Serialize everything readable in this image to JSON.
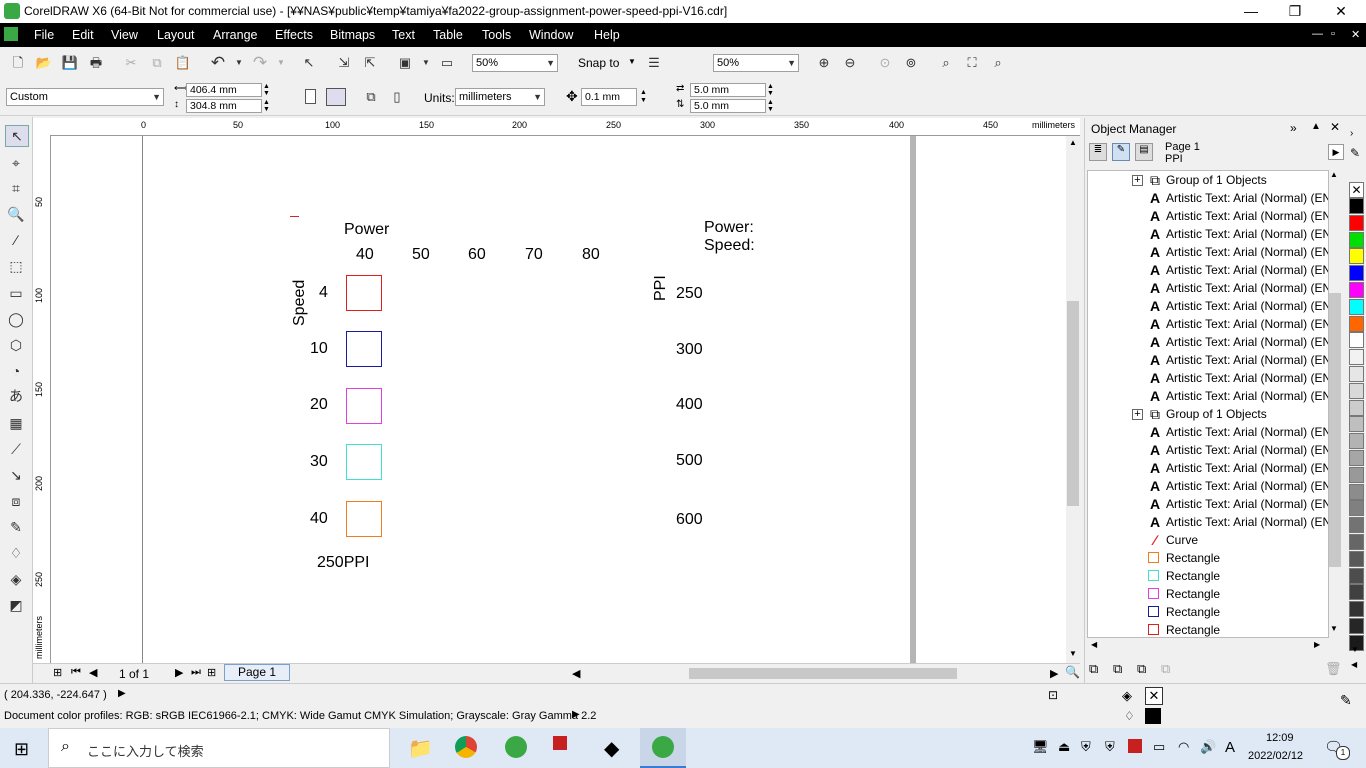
{
  "window": {
    "title": "CorelDRAW X6 (64-Bit Not for commercial use) - [¥¥NAS¥public¥temp¥tamiya¥fa2022-group-assignment-power-speed-ppi-V16.cdr]",
    "minimize": "—",
    "restore": "❐",
    "close": "✕"
  },
  "menu": {
    "items": [
      "File",
      "Edit",
      "View",
      "Layout",
      "Arrange",
      "Effects",
      "Bitmaps",
      "Text",
      "Table",
      "Tools",
      "Window",
      "Help"
    ],
    "doc_controls": [
      "—",
      "▫",
      "✕"
    ]
  },
  "toolbar1": {
    "zoom_value": "50%",
    "snap_to": "Snap to",
    "zoom_value2": "50%"
  },
  "toolbar2": {
    "page_preset": "Custom",
    "width": "406.4 mm",
    "height": "304.8 mm",
    "units_label": "Units:",
    "units_value": "millimeters",
    "nudge": "0.1 mm",
    "dup_x": "5.0 mm",
    "dup_y": "5.0 mm"
  },
  "ruler": {
    "h_labels": [
      "0",
      "50",
      "100",
      "150",
      "200",
      "250",
      "300",
      "350",
      "400",
      "450"
    ],
    "h_unit": "millimeters",
    "v_labels": [
      "50",
      "100",
      "150",
      "200",
      "250"
    ],
    "v_unit": "millimeters"
  },
  "canvas": {
    "power_label": "Power",
    "power_values": [
      "40",
      "50",
      "60",
      "70",
      "80"
    ],
    "speed_label": "Speed",
    "speed_values": [
      "4",
      "10",
      "20",
      "30",
      "40"
    ],
    "square_colors": [
      "#e02020",
      "#1a1aa0",
      "#e040e0",
      "#40e0d0",
      "#f07c20"
    ],
    "footer_label": "250PPI",
    "right_power": "Power:",
    "right_speed": "Speed:",
    "ppi_label": "PPI",
    "ppi_values": [
      "250",
      "300",
      "400",
      "500",
      "600"
    ]
  },
  "page_nav": {
    "page_count": "1 of 1",
    "page_tab": "Page 1"
  },
  "object_manager": {
    "title": "Object Manager",
    "page": "Page 1",
    "layer": "PPI",
    "rows": [
      {
        "type": "group",
        "label": "Group of 1 Objects"
      },
      {
        "type": "text",
        "label": "Artistic Text: Arial (Normal) (EN"
      },
      {
        "type": "text",
        "label": "Artistic Text: Arial (Normal) (EN"
      },
      {
        "type": "text",
        "label": "Artistic Text: Arial (Normal) (EN"
      },
      {
        "type": "text",
        "label": "Artistic Text: Arial (Normal) (EN"
      },
      {
        "type": "text",
        "label": "Artistic Text: Arial (Normal) (EN"
      },
      {
        "type": "text",
        "label": "Artistic Text: Arial (Normal) (EN"
      },
      {
        "type": "text",
        "label": "Artistic Text: Arial (Normal) (EN"
      },
      {
        "type": "text",
        "label": "Artistic Text: Arial (Normal) (EN"
      },
      {
        "type": "text",
        "label": "Artistic Text: Arial (Normal) (EN"
      },
      {
        "type": "text",
        "label": "Artistic Text: Arial (Normal) (EN"
      },
      {
        "type": "text",
        "label": "Artistic Text: Arial (Normal) (EN"
      },
      {
        "type": "text",
        "label": "Artistic Text: Arial (Normal) (EN"
      },
      {
        "type": "group",
        "label": "Group of 1 Objects"
      },
      {
        "type": "text",
        "label": "Artistic Text: Arial (Normal) (EN"
      },
      {
        "type": "text",
        "label": "Artistic Text: Arial (Normal) (EN"
      },
      {
        "type": "text",
        "label": "Artistic Text: Arial (Normal) (EN"
      },
      {
        "type": "text",
        "label": "Artistic Text: Arial (Normal) (EN"
      },
      {
        "type": "text",
        "label": "Artistic Text: Arial (Normal) (EN"
      },
      {
        "type": "text",
        "label": "Artistic Text: Arial (Normal) (EN"
      },
      {
        "type": "curve",
        "label": "Curve",
        "color": "#e02020"
      },
      {
        "type": "rect",
        "label": "Rectangle",
        "color": "#f07c20"
      },
      {
        "type": "rect",
        "label": "Rectangle",
        "color": "#40e0d0"
      },
      {
        "type": "rect",
        "label": "Rectangle",
        "color": "#e040e0"
      },
      {
        "type": "rect",
        "label": "Rectangle",
        "color": "#1a1aa0"
      },
      {
        "type": "rect",
        "label": "Rectangle",
        "color": "#e02020"
      }
    ]
  },
  "palette": [
    "#000000",
    "#ff0000",
    "#00e000",
    "#ffff00",
    "#0000ff",
    "#ff00ff",
    "#00ffff",
    "#ff6600",
    "#ffffff",
    "#f2f2f2",
    "#e6e6e6",
    "#d9d9d9",
    "#cccccc",
    "#bfbfbf",
    "#b3b3b3",
    "#a6a6a6",
    "#999999",
    "#8c8c8c",
    "#808080",
    "#737373",
    "#666666",
    "#595959",
    "#4d4d4d",
    "#404040",
    "#333333",
    "#262626",
    "#1a1a1a"
  ],
  "status": {
    "coords": "( 204.336, -224.647 )",
    "profiles": "Document color profiles: RGB: sRGB IEC61966-2.1; CMYK: Wide Gamut CMYK Simulation; Grayscale: Gray Gamma 2.2"
  },
  "taskbar": {
    "search_placeholder": "ここに入力して検索",
    "time": "12:09",
    "date": "2022/02/12",
    "ime": "A",
    "notif_count": "1"
  }
}
